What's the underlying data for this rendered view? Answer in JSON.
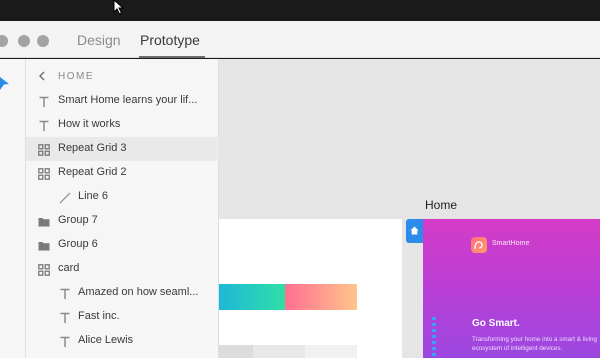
{
  "titlebar": {
    "tabs": [
      {
        "label": "Design",
        "active": false
      },
      {
        "label": "Prototype",
        "active": true
      }
    ]
  },
  "layers_panel": {
    "header": "HOME",
    "items": [
      {
        "icon": "text-icon",
        "label": "Smart Home learns your lif...",
        "indent": 0,
        "selected": false
      },
      {
        "icon": "text-icon",
        "label": "How it works",
        "indent": 0,
        "selected": false
      },
      {
        "icon": "repeat-grid-icon",
        "label": "Repeat Grid 3",
        "indent": 0,
        "selected": true
      },
      {
        "icon": "repeat-grid-icon",
        "label": "Repeat Grid 2",
        "indent": 0,
        "selected": false
      },
      {
        "icon": "line-icon",
        "label": "Line 6",
        "indent": 1,
        "selected": false
      },
      {
        "icon": "folder-icon",
        "label": "Group 7",
        "indent": 0,
        "selected": false
      },
      {
        "icon": "folder-icon",
        "label": "Group 6",
        "indent": 0,
        "selected": false
      },
      {
        "icon": "repeat-grid-icon",
        "label": "card",
        "indent": 0,
        "selected": false
      },
      {
        "icon": "text-icon",
        "label": "Amazed on how seaml...",
        "indent": 1,
        "selected": false
      },
      {
        "icon": "text-icon",
        "label": "Fast inc.",
        "indent": 1,
        "selected": false
      },
      {
        "icon": "text-icon",
        "label": "Alice Lewis",
        "indent": 1,
        "selected": false
      }
    ]
  },
  "canvas": {
    "artboard_label": "Home",
    "brand_name": "SmartHome",
    "headline": "Go Smart.",
    "tagline": "Transforming your home into a smart & living ecosystem of intelligent devices."
  },
  "colors": {
    "flow_blue": "#2d8ceb",
    "purple_top": "#d43bc7",
    "purple_bottom": "#9b48e0"
  }
}
